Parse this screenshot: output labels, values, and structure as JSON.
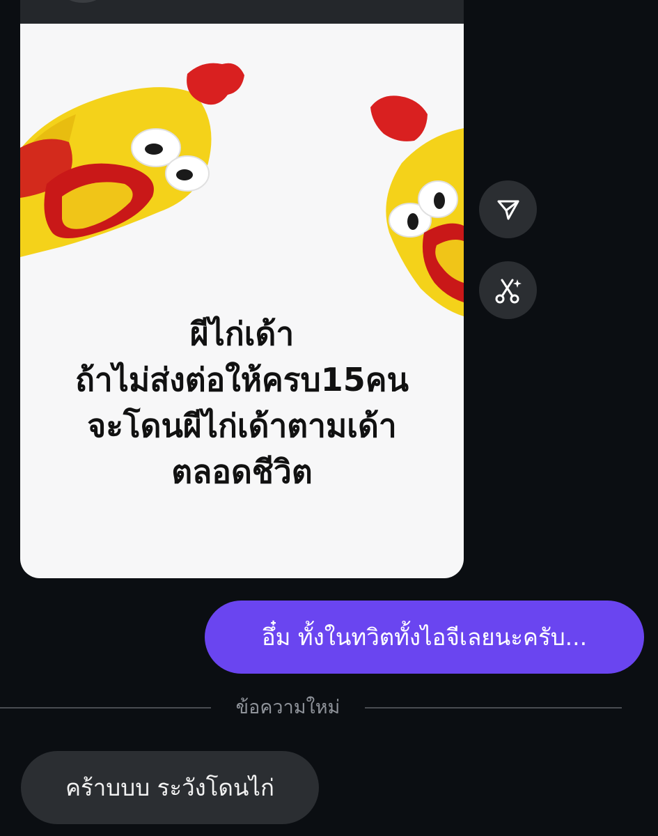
{
  "media": {
    "image_icon": "rubber-chicken-meme-image",
    "caption_lines": [
      "ผีไก่เด้า",
      "ถ้าไม่ส่งต่อให้ครบ15คน",
      "จะโดนผีไก่เด้าตามเด้า",
      "ตลอดชีวิต"
    ]
  },
  "actions": {
    "share_icon": "paper-plane-icon",
    "remix_icon": "scissors-sparkle-icon"
  },
  "messages": {
    "outgoing": "อึ๋ม ทั้งในทวิตทั้งไอจีเลยนะครับ...",
    "divider_label": "ข้อความใหม่",
    "incoming": "คร้าบบบ ระวังโดนไก่"
  },
  "colors": {
    "background": "#0b0e12",
    "outgoing_bubble": "#6a45f0",
    "incoming_bubble": "#2b2e32",
    "action_button": "#2b2e32"
  }
}
